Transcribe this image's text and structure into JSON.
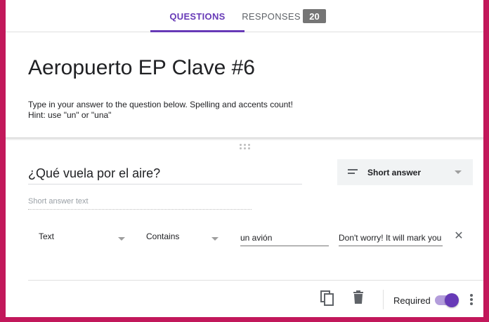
{
  "tabs": {
    "questions": "QUESTIONS",
    "responses": "RESPONSES",
    "responses_count": "20"
  },
  "form": {
    "title": "Aeropuerto EP Clave #6",
    "description": "Type in your answer to the question below. Spelling and accents count!\nHint: use \"un\" or \"una\""
  },
  "question": {
    "title": "¿Qué vuela por el aire?",
    "type_label": "Short answer",
    "short_answer_placeholder": "Short answer text",
    "validation": {
      "type": "Text",
      "condition": "Contains",
      "value": "un avión",
      "error_text": "Don't worry! It will mark you wrong"
    },
    "required_label": "Required",
    "required": true
  },
  "icons": {
    "type": "short-text-icon",
    "clear": "close-icon",
    "copy": "copy-icon",
    "delete": "trash-icon",
    "more": "more-vert-icon",
    "drag": "drag-handle-icon"
  },
  "colors": {
    "accent": "#673ab7",
    "accent_light": "#b39ddb",
    "frame": "#c2185b"
  }
}
